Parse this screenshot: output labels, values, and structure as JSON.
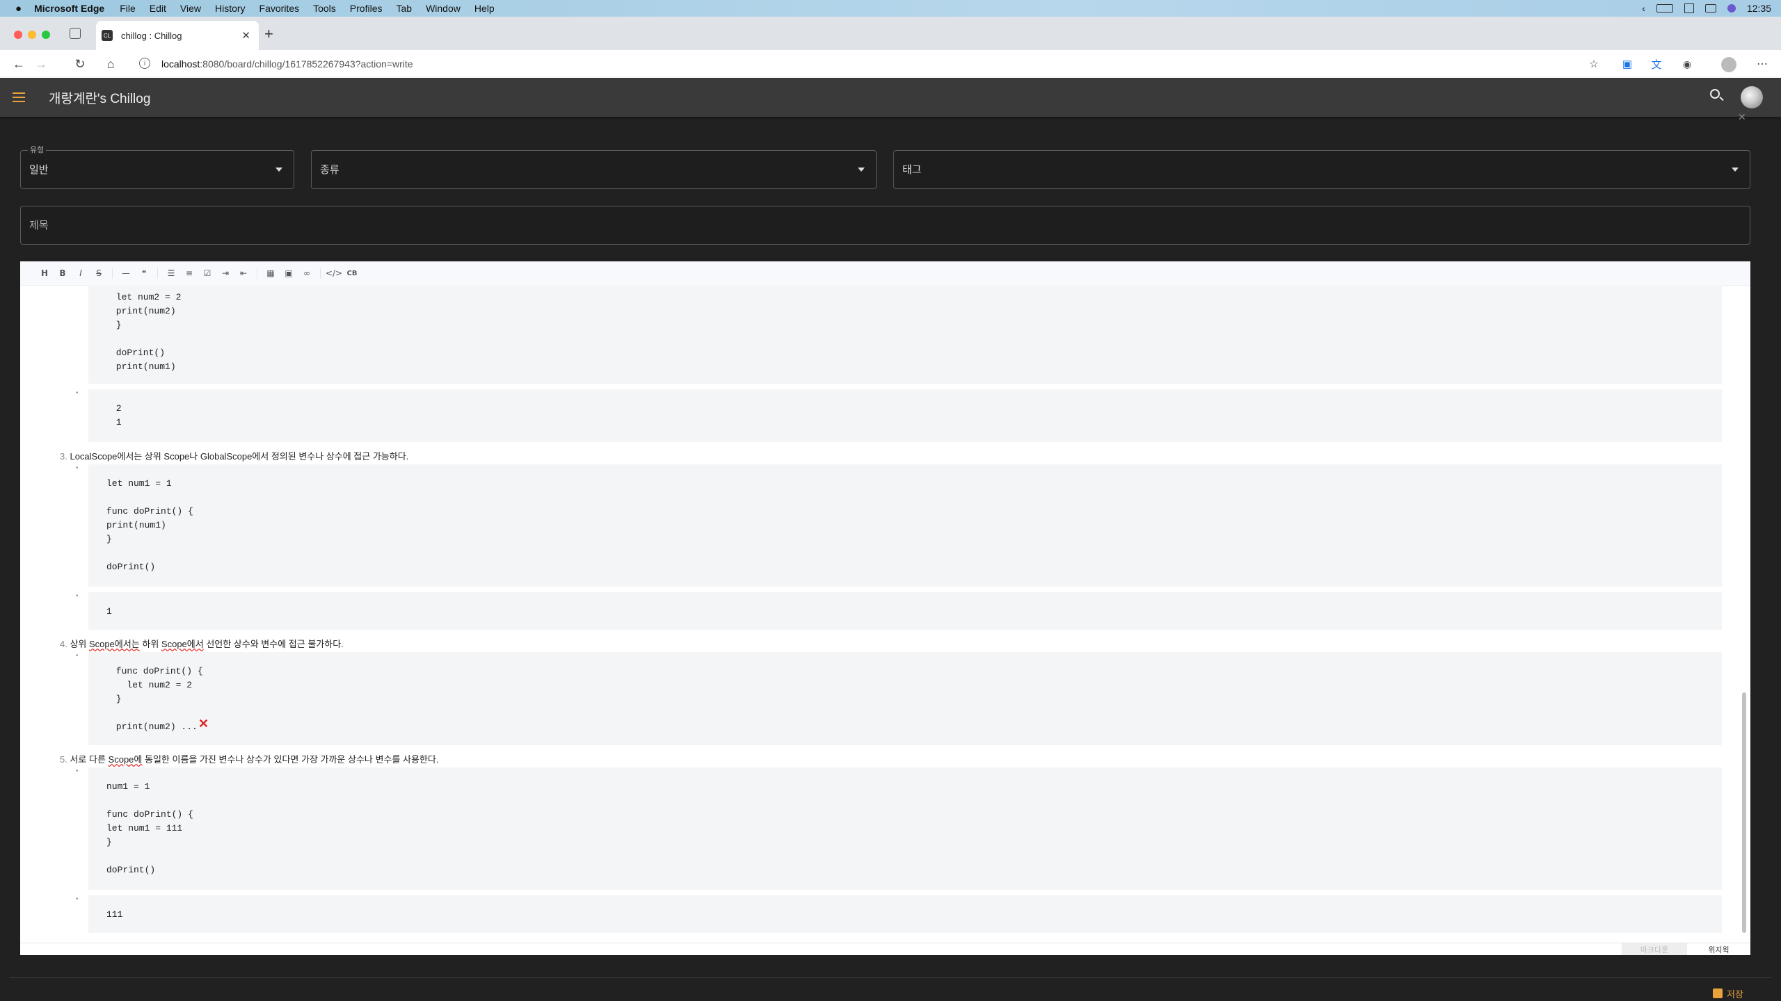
{
  "menubar": {
    "app": "Microsoft Edge",
    "items": [
      "File",
      "Edit",
      "View",
      "History",
      "Favorites",
      "Tools",
      "Profiles",
      "Tab",
      "Window",
      "Help"
    ],
    "time": "12:35"
  },
  "browser": {
    "tab_title": "chillog : Chillog",
    "favicon": "CL",
    "url_host": "localhost",
    "url_rest": ":8080/board/chillog/1617852267943?action=write"
  },
  "app": {
    "title": "개랑계란's Chillog"
  },
  "form": {
    "type_label": "유형",
    "type_value": "일반",
    "kind_placeholder": "종류",
    "tag_placeholder": "태그",
    "title_placeholder": "제목"
  },
  "toolbar": {
    "buttons": [
      "H",
      "B",
      "I",
      "S",
      "—",
      "❝",
      "list",
      "olist",
      "task",
      "indent",
      "outdent",
      "table",
      "image",
      "link",
      "code",
      "CB"
    ]
  },
  "content": {
    "block1_code": " let num2 = 2\n print(num2)\n }\n\n doPrint()\n print(num1)",
    "block1_out": " 2\n 1",
    "item3_num": "3.",
    "item3_text": "LocalScope에서는 상위 Scope나 GlobalScope에서 정의된 변수나 상수에 접근 가능하다.",
    "block3_code": "let num1 = 1\n\nfunc doPrint() {\nprint(num1)\n}\n\ndoPrint()",
    "block3_out": "1",
    "item4_num": "4.",
    "item4_text_a": "상위 ",
    "item4_text_b": "Scope에서는",
    "item4_text_c": " 하위 ",
    "item4_text_d": "Scope에서",
    "item4_text_e": " 선언한 상수와 변수에 접근 불가하다.",
    "block4_code": " func doPrint() {\n   let num2 = 2\n }\n\n print(num2) ...",
    "block4_mark": "✕",
    "item5_num": "5.",
    "item5_text_a": "서로 다른 ",
    "item5_text_b": "Scope에",
    "item5_text_c": " 동일한 이름을 가진 변수나 상수가 있다면 가장 가까운 상수나 변수를 사용한다.",
    "block5_code": "num1 = 1\n\nfunc doPrint() {\nlet num1 = 111\n}\n\ndoPrint()",
    "block5_out": "111",
    "bullet": "•"
  },
  "modes": {
    "markdown": "마크다운",
    "wysiwyg": "위지윅"
  },
  "save_label": "저장"
}
